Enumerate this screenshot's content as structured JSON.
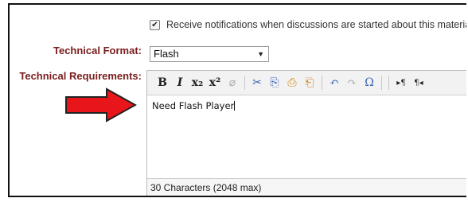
{
  "notify": {
    "checked": true,
    "label": "Receive notifications when discussions are started about this material"
  },
  "technical_format": {
    "label": "Technical Format:",
    "value": "Flash"
  },
  "technical_requirements": {
    "label": "Technical Requirements:",
    "content": "Need Flash Player",
    "status": "30 Characters (2048 max)"
  },
  "toolbar": {
    "bold": "B",
    "italic": "I",
    "subscript": "x₂",
    "superscript": "x²",
    "remove_format": "⌀",
    "cut": "✂",
    "copy": "⎘",
    "paste": "⎙",
    "paste_text": "⎗",
    "undo": "↶",
    "redo": "↷",
    "special_char": "Ω",
    "ltr": "▸¶",
    "rtl": "¶◂"
  },
  "colors": {
    "label": "#7a1d1d",
    "arrow_fill": "#e8161a",
    "arrow_stroke": "#222222"
  }
}
